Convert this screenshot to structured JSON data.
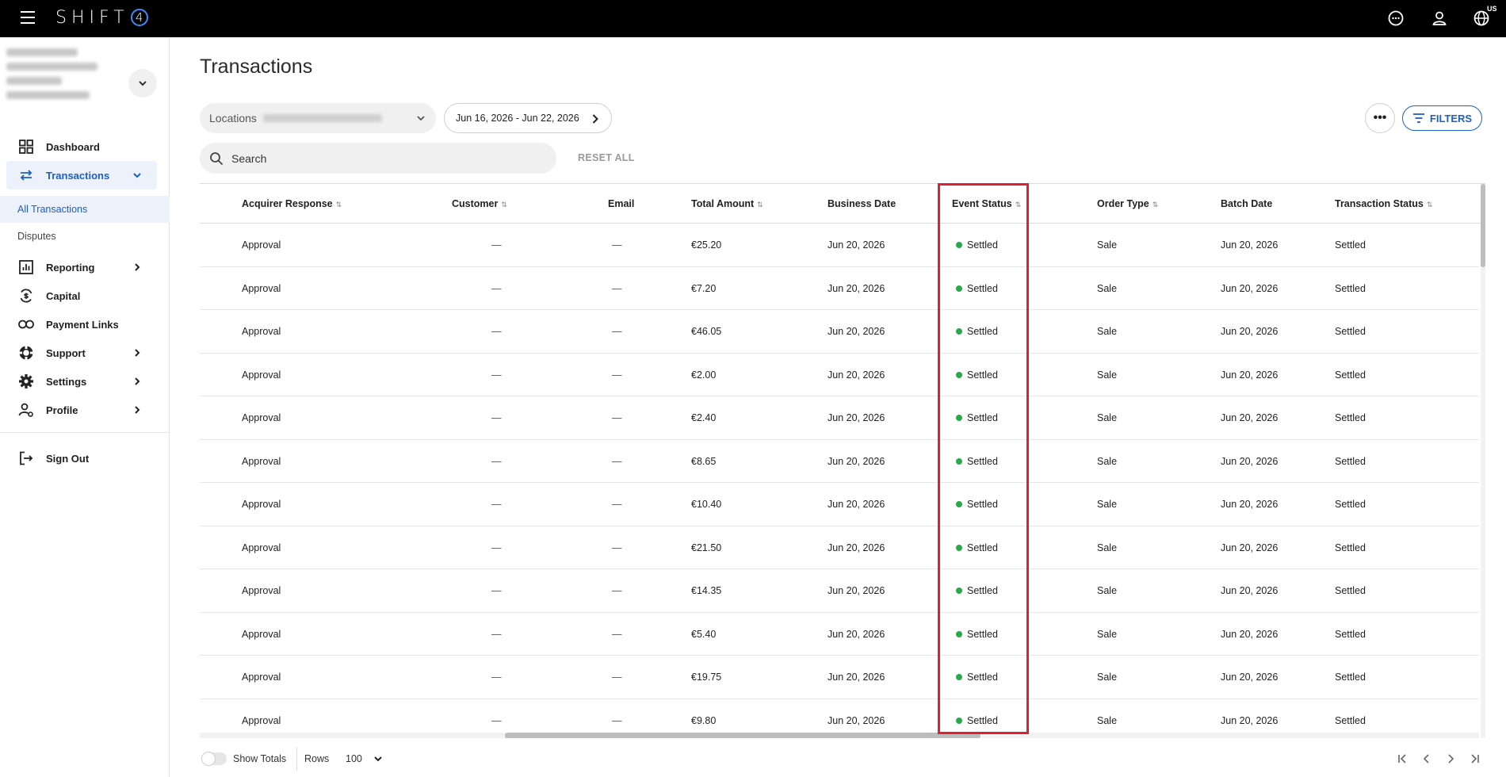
{
  "topbar": {
    "brand": "SHIFT",
    "brand_mark": "4",
    "region": "US"
  },
  "sidebar": {
    "nav": [
      {
        "label": "Dashboard",
        "icon": "dashboard-grid-icon"
      },
      {
        "label": "Transactions",
        "icon": "transfer-arrows-icon"
      },
      {
        "label": "Reporting",
        "icon": "bar-chart-icon"
      },
      {
        "label": "Capital",
        "icon": "capital-icon"
      },
      {
        "label": "Payment Links",
        "icon": "link-icon"
      },
      {
        "label": "Support",
        "icon": "lifebuoy-icon"
      },
      {
        "label": "Settings",
        "icon": "gear-icon"
      },
      {
        "label": "Profile",
        "icon": "profile-settings-icon"
      }
    ],
    "sub_items": [
      "All Transactions",
      "Disputes"
    ],
    "sign_out": "Sign Out"
  },
  "main": {
    "title": "Transactions",
    "locations_label": "Locations",
    "date_range": "Jun 16, 2026 - Jun 22, 2026",
    "filters_label": "FILTERS",
    "more_label": "•••",
    "search_placeholder": "Search",
    "reset_all": "RESET ALL"
  },
  "table": {
    "columns": [
      {
        "key": "acquirer_response",
        "label": "Acquirer Response",
        "sortable": true
      },
      {
        "key": "customer",
        "label": "Customer",
        "sortable": true
      },
      {
        "key": "email",
        "label": "Email",
        "sortable": false
      },
      {
        "key": "total_amount",
        "label": "Total Amount",
        "sortable": true
      },
      {
        "key": "business_date",
        "label": "Business Date",
        "sortable": false
      },
      {
        "key": "event_status",
        "label": "Event Status",
        "sortable": true
      },
      {
        "key": "order_type",
        "label": "Order Type",
        "sortable": true
      },
      {
        "key": "batch_date",
        "label": "Batch Date",
        "sortable": false
      },
      {
        "key": "transaction_status",
        "label": "Transaction Status",
        "sortable": true
      }
    ],
    "sort_glyph": "⇅",
    "rows": [
      {
        "acquirer_response": "Approval",
        "customer": "—",
        "email": "—",
        "total_amount": "€25.20",
        "business_date": "Jun 20, 2026",
        "event_status": "Settled",
        "order_type": "Sale",
        "batch_date": "Jun 20, 2026",
        "transaction_status": "Settled"
      },
      {
        "acquirer_response": "Approval",
        "customer": "—",
        "email": "—",
        "total_amount": "€7.20",
        "business_date": "Jun 20, 2026",
        "event_status": "Settled",
        "order_type": "Sale",
        "batch_date": "Jun 20, 2026",
        "transaction_status": "Settled"
      },
      {
        "acquirer_response": "Approval",
        "customer": "—",
        "email": "—",
        "total_amount": "€46.05",
        "business_date": "Jun 20, 2026",
        "event_status": "Settled",
        "order_type": "Sale",
        "batch_date": "Jun 20, 2026",
        "transaction_status": "Settled"
      },
      {
        "acquirer_response": "Approval",
        "customer": "—",
        "email": "—",
        "total_amount": "€2.00",
        "business_date": "Jun 20, 2026",
        "event_status": "Settled",
        "order_type": "Sale",
        "batch_date": "Jun 20, 2026",
        "transaction_status": "Settled"
      },
      {
        "acquirer_response": "Approval",
        "customer": "—",
        "email": "—",
        "total_amount": "€2.40",
        "business_date": "Jun 20, 2026",
        "event_status": "Settled",
        "order_type": "Sale",
        "batch_date": "Jun 20, 2026",
        "transaction_status": "Settled"
      },
      {
        "acquirer_response": "Approval",
        "customer": "—",
        "email": "—",
        "total_amount": "€8.65",
        "business_date": "Jun 20, 2026",
        "event_status": "Settled",
        "order_type": "Sale",
        "batch_date": "Jun 20, 2026",
        "transaction_status": "Settled"
      },
      {
        "acquirer_response": "Approval",
        "customer": "—",
        "email": "—",
        "total_amount": "€10.40",
        "business_date": "Jun 20, 2026",
        "event_status": "Settled",
        "order_type": "Sale",
        "batch_date": "Jun 20, 2026",
        "transaction_status": "Settled"
      },
      {
        "acquirer_response": "Approval",
        "customer": "—",
        "email": "—",
        "total_amount": "€21.50",
        "business_date": "Jun 20, 2026",
        "event_status": "Settled",
        "order_type": "Sale",
        "batch_date": "Jun 20, 2026",
        "transaction_status": "Settled"
      },
      {
        "acquirer_response": "Approval",
        "customer": "—",
        "email": "—",
        "total_amount": "€14.35",
        "business_date": "Jun 20, 2026",
        "event_status": "Settled",
        "order_type": "Sale",
        "batch_date": "Jun 20, 2026",
        "transaction_status": "Settled"
      },
      {
        "acquirer_response": "Approval",
        "customer": "—",
        "email": "—",
        "total_amount": "€5.40",
        "business_date": "Jun 20, 2026",
        "event_status": "Settled",
        "order_type": "Sale",
        "batch_date": "Jun 20, 2026",
        "transaction_status": "Settled"
      },
      {
        "acquirer_response": "Approval",
        "customer": "—",
        "email": "—",
        "total_amount": "€19.75",
        "business_date": "Jun 20, 2026",
        "event_status": "Settled",
        "order_type": "Sale",
        "batch_date": "Jun 20, 2026",
        "transaction_status": "Settled"
      },
      {
        "acquirer_response": "Approval",
        "customer": "—",
        "email": "—",
        "total_amount": "€9.80",
        "business_date": "Jun 20, 2026",
        "event_status": "Settled",
        "order_type": "Sale",
        "batch_date": "Jun 20, 2026",
        "transaction_status": "Settled"
      }
    ]
  },
  "footer": {
    "show_totals": "Show Totals",
    "show_totals_on": false,
    "rows_label": "Rows",
    "rows_value": "100"
  },
  "colors": {
    "accent": "#1b5fc9",
    "settled_dot": "#2aa84a",
    "highlight": "#e0202e",
    "topbar": "#000000"
  }
}
